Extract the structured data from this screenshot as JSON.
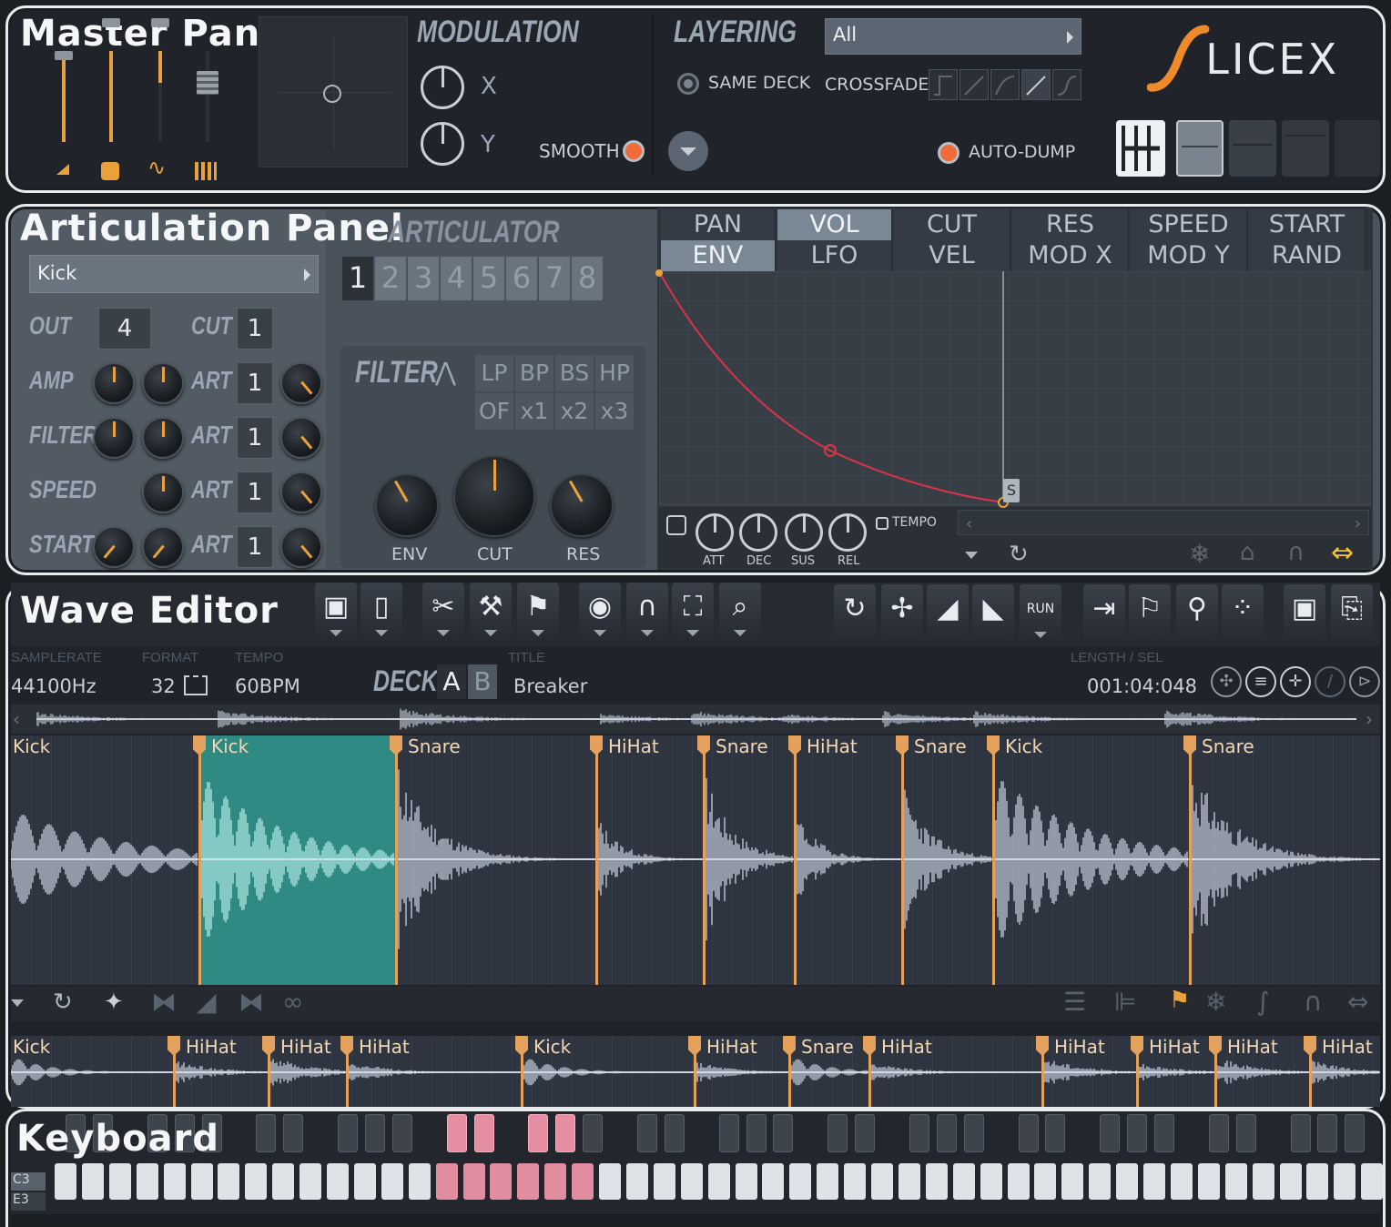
{
  "master": {
    "title": "Master Panel",
    "modulation_label": "MODULATION",
    "mod_x": "X",
    "mod_y": "Y",
    "smooth": "SMOOTH",
    "layering_label": "LAYERING",
    "layering_value": "All",
    "same_deck": "SAME DECK",
    "crossfade": "CROSSFADE",
    "auto_dump": "AUTO-DUMP",
    "logo": "SLICEX"
  },
  "articulation": {
    "title": "Articulation Panel",
    "articulator_label": "ARTICULATOR",
    "selected": "Kick",
    "numbers": [
      "1",
      "2",
      "3",
      "4",
      "5",
      "6",
      "7",
      "8"
    ],
    "rows": [
      {
        "label": "OUT",
        "value": "4",
        "right_label": "CUT",
        "right_value": "1"
      },
      {
        "label": "AMP",
        "right_label": "ART",
        "right_value": "1"
      },
      {
        "label": "FILTER",
        "right_label": "ART",
        "right_value": "1"
      },
      {
        "label": "SPEED",
        "right_label": "ART",
        "right_value": "1"
      },
      {
        "label": "START",
        "right_label": "ART",
        "right_value": "1"
      }
    ],
    "filter_label": "FILTER",
    "filter_types": [
      "LP",
      "BP",
      "BS",
      "HP"
    ],
    "filter_mult": [
      "OF",
      "x1",
      "x2",
      "x3"
    ],
    "filter_knobs": [
      "ENV",
      "CUT",
      "RES"
    ],
    "tabs_row1": [
      "PAN",
      "VOL",
      "CUT",
      "RES",
      "SPEED",
      "START"
    ],
    "tabs_row2": [
      "ENV",
      "LFO",
      "VEL",
      "MOD X",
      "MOD Y",
      "RAND"
    ],
    "env_knobs": [
      "ATT",
      "DEC",
      "SUS",
      "REL"
    ],
    "tempo": "TEMPO",
    "sustain_marker": "S"
  },
  "wave": {
    "title": "Wave Editor",
    "samplerate_label": "SAMPLERATE",
    "samplerate": "44100Hz",
    "format_label": "FORMAT",
    "format": "32",
    "tempo_label": "TEMPO",
    "tempo": "60BPM",
    "deck_label": "DECK",
    "deck_a": "A",
    "deck_b": "B",
    "title_label": "TITLE",
    "sample_title": "Breaker",
    "length_label": "LENGTH / SEL",
    "length": "001:04:048",
    "slices": [
      "Kick",
      "Kick",
      "Snare",
      "HiHat",
      "Snare",
      "HiHat",
      "Snare",
      "Kick",
      "Snare"
    ],
    "deck_b_slices": [
      "Kick",
      "HiHat",
      "HiHat",
      "HiHat",
      "Kick",
      "HiHat",
      "Snare",
      "HiHat",
      "HiHat",
      "HiHat",
      "HiHat",
      "HiHat"
    ]
  },
  "keyboard": {
    "title": "Keyboard",
    "oct_top": "C3",
    "oct_bottom": "E3"
  },
  "colors": {
    "accent": "#e9a23b",
    "marker": "#e3a15c",
    "selection": "#2f8a84",
    "env_curve": "#d9344a",
    "key_on": "#e18da0"
  }
}
